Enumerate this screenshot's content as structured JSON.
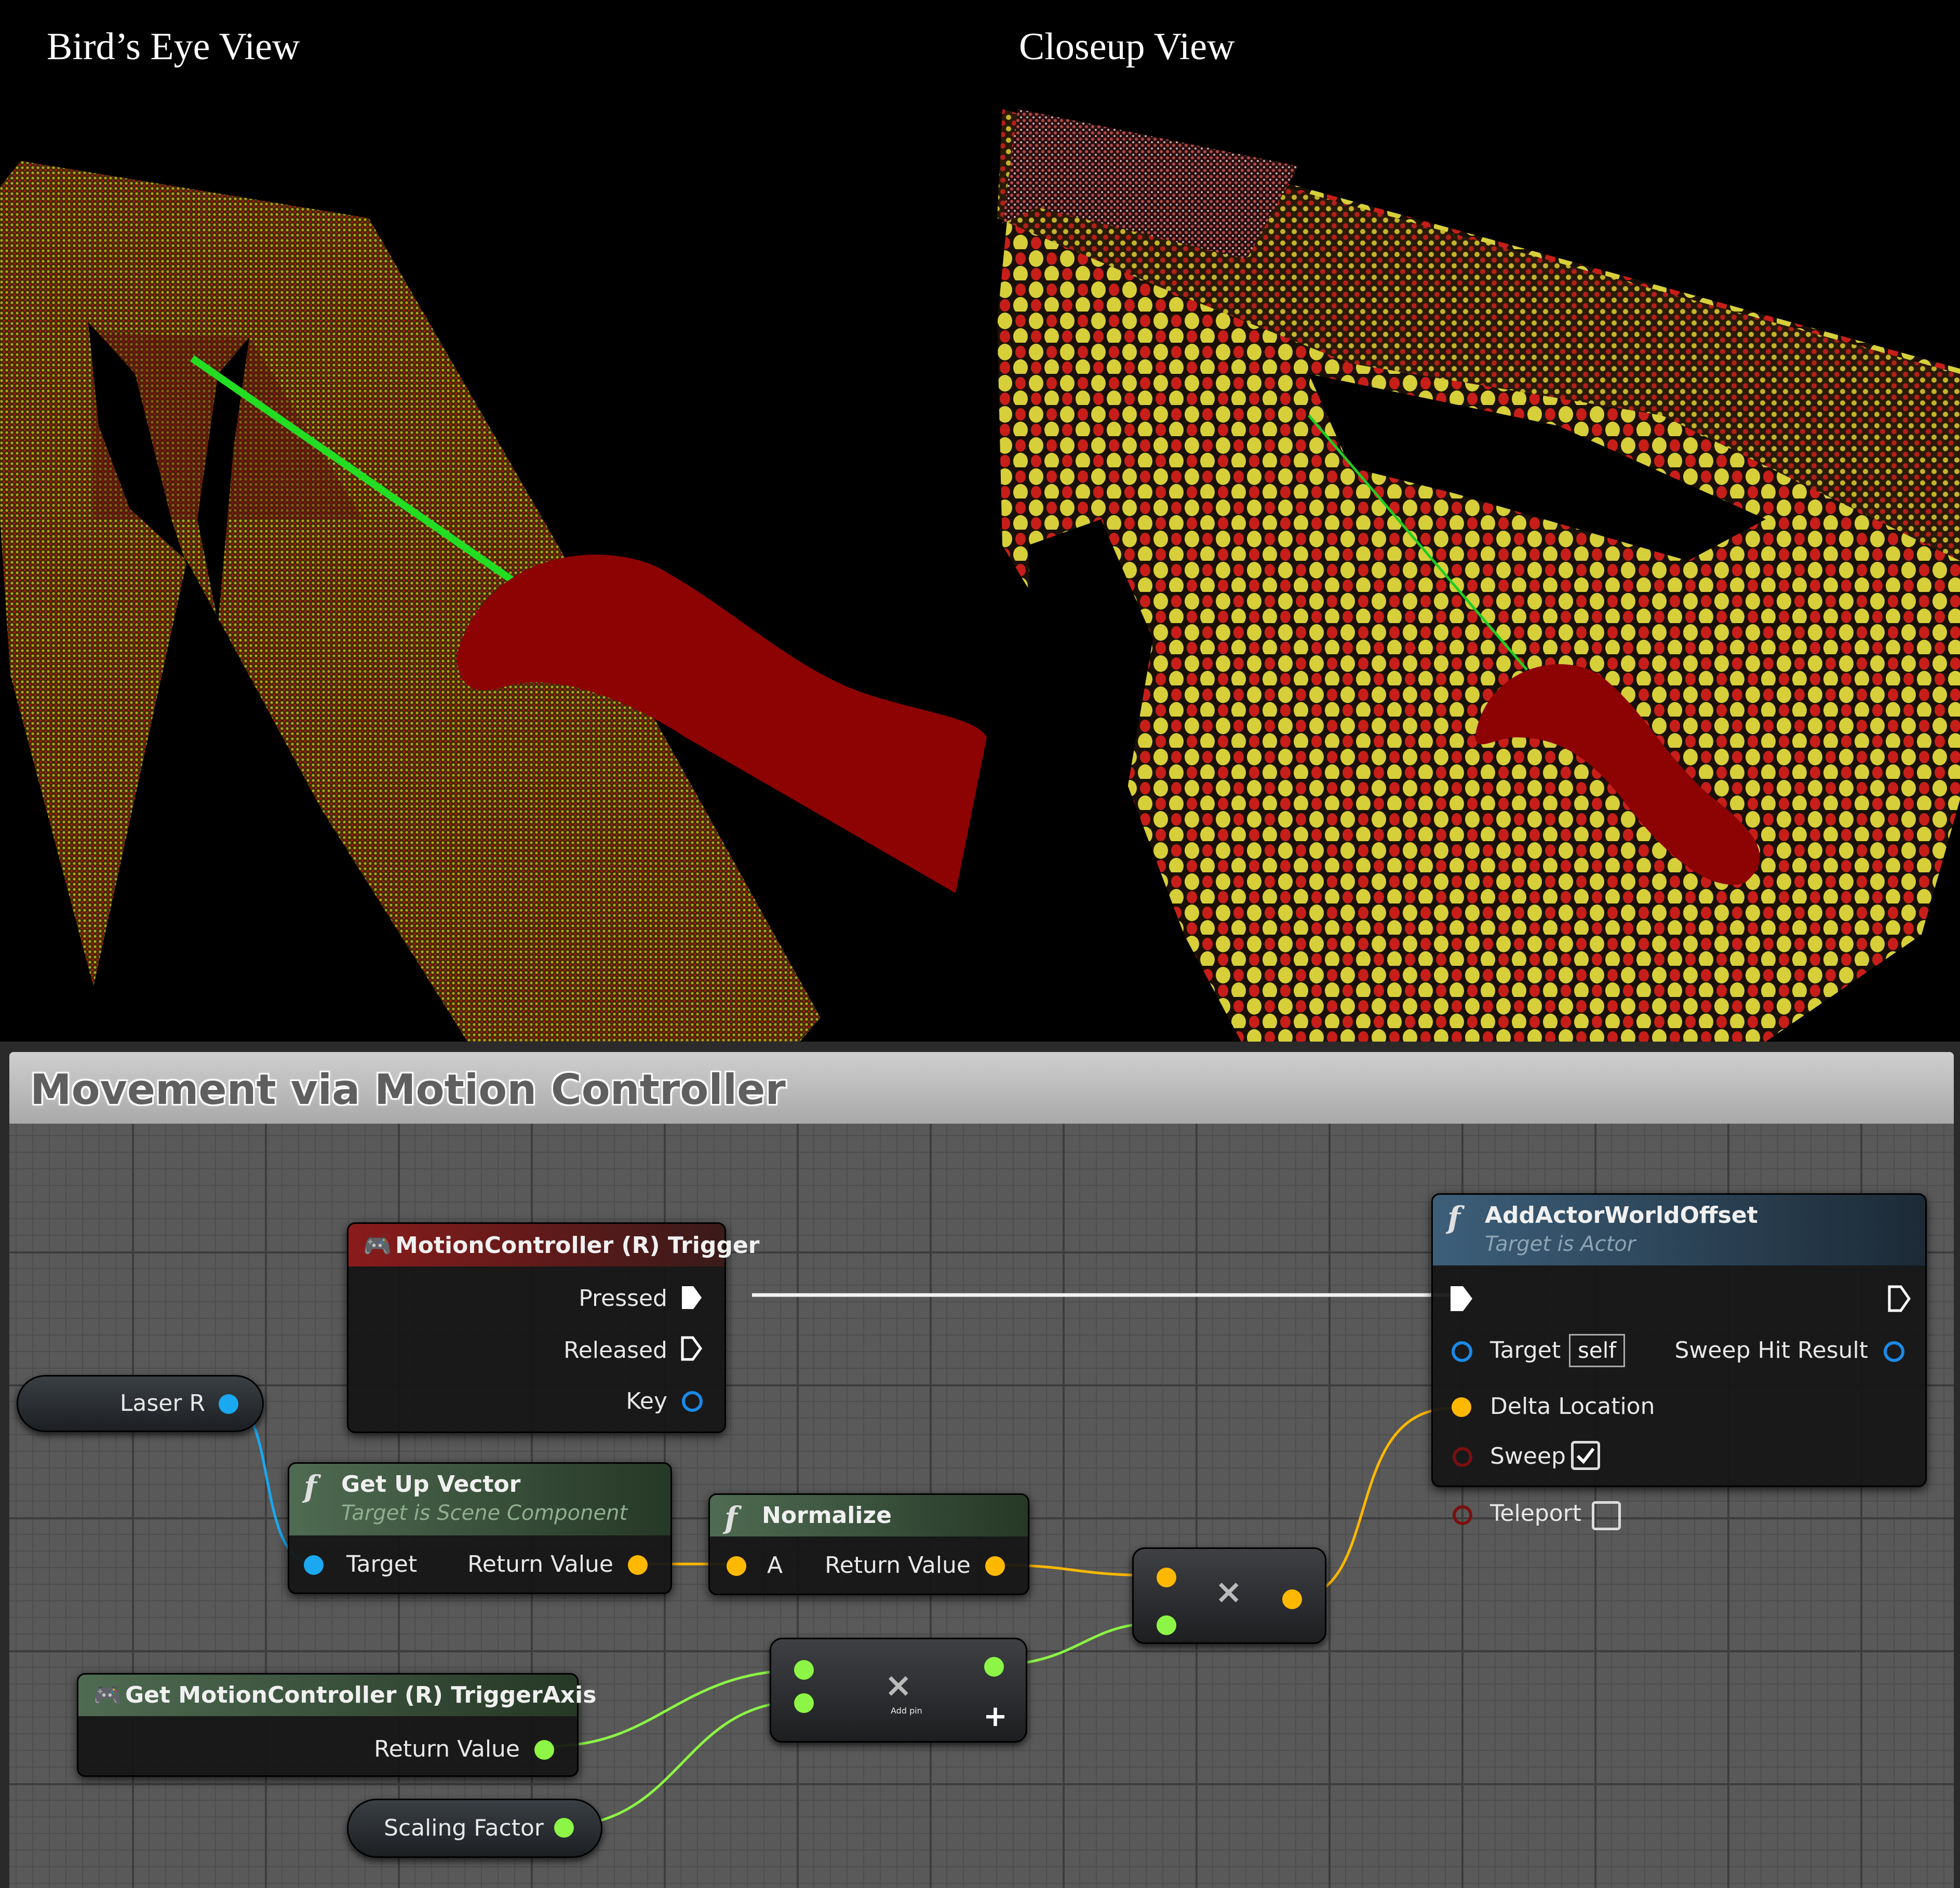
{
  "views": {
    "left_title": "Bird’s Eye View",
    "right_title": "Closeup View"
  },
  "blueprint": {
    "title": "Movement via Motion Controller",
    "colors": {
      "exec": "#ffffff",
      "vector": "#ffb800",
      "float": "#8cf545",
      "object": "#1aa8f0",
      "event_header": "#8a1b1b",
      "function_header": "#4f6b52",
      "call_header": "#3d5f7a"
    },
    "trigger_node": {
      "title": "MotionController (R) Trigger",
      "icon": "gamepad-icon",
      "pins": {
        "pressed": "Pressed",
        "released": "Released",
        "key": "Key"
      }
    },
    "laser_node": {
      "label": "Laser R"
    },
    "get_up_vector_node": {
      "title": "Get Up Vector",
      "subtitle": "Target is Scene Component",
      "icon": "function-icon",
      "pins": {
        "target": "Target",
        "return": "Return Value"
      }
    },
    "normalize_node": {
      "title": "Normalize",
      "icon": "function-icon",
      "pins": {
        "a": "A",
        "return": "Return Value"
      }
    },
    "multiply_vector_node": {
      "symbol": "×"
    },
    "multiply_float_node": {
      "symbol": "×",
      "add_pin": "Add pin"
    },
    "trigger_axis_node": {
      "title": "Get MotionController (R) TriggerAxis",
      "icon": "gamepad-icon",
      "pins": {
        "return": "Return Value"
      }
    },
    "scaling_node": {
      "label": "Scaling Factor"
    },
    "add_offset_node": {
      "title": "AddActorWorldOffset",
      "subtitle": "Target is Actor",
      "icon": "function-icon",
      "pins": {
        "target": "Target",
        "target_default": "self",
        "sweep_hit_result": "Sweep Hit Result",
        "delta_location": "Delta Location",
        "sweep": "Sweep",
        "sweep_checked": true,
        "teleport": "Teleport",
        "teleport_checked": false
      }
    }
  }
}
